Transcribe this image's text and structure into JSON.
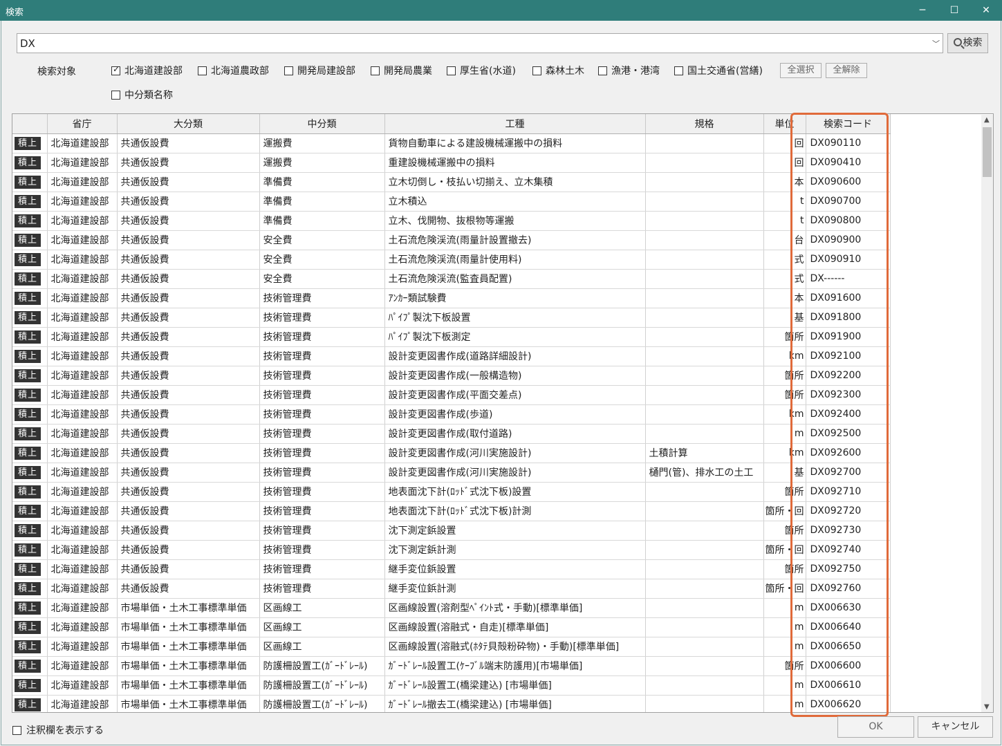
{
  "window": {
    "title": "検索",
    "min": "─",
    "max": "☐",
    "close": "✕"
  },
  "search": {
    "value": "DX",
    "button_label": "検索"
  },
  "targets": {
    "label": "検索対象",
    "items": [
      {
        "label": "北海道建設部",
        "checked": true
      },
      {
        "label": "北海道農政部",
        "checked": false
      },
      {
        "label": "開発局建設部",
        "checked": false
      },
      {
        "label": "開発局農業",
        "checked": false
      },
      {
        "label": "厚生省(水道)",
        "checked": false
      },
      {
        "label": "森林土木",
        "checked": false
      },
      {
        "label": "漁港・港湾",
        "checked": false
      },
      {
        "label": "国土交通省(営繕)",
        "checked": false
      }
    ],
    "select_all": "全選択",
    "clear_all": "全解除",
    "middle_name": {
      "label": "中分類名称",
      "checked": false
    }
  },
  "table": {
    "headers": [
      "",
      "省庁",
      "大分類",
      "中分類",
      "工種",
      "規格",
      "単位",
      "検索コード"
    ],
    "tag": "積上",
    "rows": [
      [
        "北海道建設部",
        "共通仮設費",
        "運搬費",
        "貨物自動車による建設機械運搬中の損料",
        "",
        "回",
        "DX090110"
      ],
      [
        "北海道建設部",
        "共通仮設費",
        "運搬費",
        "重建設機械運搬中の損料",
        "",
        "回",
        "DX090410"
      ],
      [
        "北海道建設部",
        "共通仮設費",
        "準備費",
        "立木切倒し・枝払い切揃え、立木集積",
        "",
        "本",
        "DX090600"
      ],
      [
        "北海道建設部",
        "共通仮設費",
        "準備費",
        "立木積込",
        "",
        "t",
        "DX090700"
      ],
      [
        "北海道建設部",
        "共通仮設費",
        "準備費",
        "立木、伐開物、抜根物等運搬",
        "",
        "t",
        "DX090800"
      ],
      [
        "北海道建設部",
        "共通仮設費",
        "安全費",
        "土石流危険渓流(雨量計設置撤去)",
        "",
        "台",
        "DX090900"
      ],
      [
        "北海道建設部",
        "共通仮設費",
        "安全費",
        "土石流危険渓流(雨量計使用料)",
        "",
        "式",
        "DX090910"
      ],
      [
        "北海道建設部",
        "共通仮設費",
        "安全費",
        "土石流危険渓流(監査員配置)",
        "",
        "式",
        "DX------"
      ],
      [
        "北海道建設部",
        "共通仮設費",
        "技術管理費",
        "ｱﾝｶｰ類試験費",
        "",
        "本",
        "DX091600"
      ],
      [
        "北海道建設部",
        "共通仮設費",
        "技術管理費",
        "ﾊﾟｲﾌﾟ製沈下板設置",
        "",
        "基",
        "DX091800"
      ],
      [
        "北海道建設部",
        "共通仮設費",
        "技術管理費",
        "ﾊﾟｲﾌﾟ製沈下板測定",
        "",
        "箇所",
        "DX091900"
      ],
      [
        "北海道建設部",
        "共通仮設費",
        "技術管理費",
        "設計変更図書作成(道路詳細設計)",
        "",
        "km",
        "DX092100"
      ],
      [
        "北海道建設部",
        "共通仮設費",
        "技術管理費",
        "設計変更図書作成(一般構造物)",
        "",
        "箇所",
        "DX092200"
      ],
      [
        "北海道建設部",
        "共通仮設費",
        "技術管理費",
        "設計変更図書作成(平面交差点)",
        "",
        "箇所",
        "DX092300"
      ],
      [
        "北海道建設部",
        "共通仮設費",
        "技術管理費",
        "設計変更図書作成(歩道)",
        "",
        "km",
        "DX092400"
      ],
      [
        "北海道建設部",
        "共通仮設費",
        "技術管理費",
        "設計変更図書作成(取付道路)",
        "",
        "m",
        "DX092500"
      ],
      [
        "北海道建設部",
        "共通仮設費",
        "技術管理費",
        "設計変更図書作成(河川実施設計)",
        "土積計算",
        "km",
        "DX092600"
      ],
      [
        "北海道建設部",
        "共通仮設費",
        "技術管理費",
        "設計変更図書作成(河川実施設計)",
        "樋門(管)、排水工の土工",
        "基",
        "DX092700"
      ],
      [
        "北海道建設部",
        "共通仮設費",
        "技術管理費",
        "地表面沈下計(ﾛｯﾄﾞ式沈下板)設置",
        "",
        "箇所",
        "DX092710"
      ],
      [
        "北海道建設部",
        "共通仮設費",
        "技術管理費",
        "地表面沈下計(ﾛｯﾄﾞ式沈下板)計測",
        "",
        "箇所・回",
        "DX092720"
      ],
      [
        "北海道建設部",
        "共通仮設費",
        "技術管理費",
        "沈下測定鋲設置",
        "",
        "箇所",
        "DX092730"
      ],
      [
        "北海道建設部",
        "共通仮設費",
        "技術管理費",
        "沈下測定鋲計測",
        "",
        "箇所・回",
        "DX092740"
      ],
      [
        "北海道建設部",
        "共通仮設費",
        "技術管理費",
        "継手変位鋲設置",
        "",
        "箇所",
        "DX092750"
      ],
      [
        "北海道建設部",
        "共通仮設費",
        "技術管理費",
        "継手変位鋲計測",
        "",
        "箇所・回",
        "DX092760"
      ],
      [
        "北海道建設部",
        "市場単価・土木工事標準単価",
        "区画線工",
        "区画線設置(溶剤型ﾍﾟｲﾝﾄ式・手動)[標準単価]",
        "",
        "m",
        "DX006630"
      ],
      [
        "北海道建設部",
        "市場単価・土木工事標準単価",
        "区画線工",
        "区画線設置(溶融式・自走)[標準単価]",
        "",
        "m",
        "DX006640"
      ],
      [
        "北海道建設部",
        "市場単価・土木工事標準単価",
        "区画線工",
        "区画線設置(溶融式(ﾎﾀﾃ貝殻粉砕物)・手動)[標準単価]",
        "",
        "m",
        "DX006650"
      ],
      [
        "北海道建設部",
        "市場単価・土木工事標準単価",
        "防護柵設置工(ｶﾞｰﾄﾞﾚｰﾙ)",
        "ｶﾞｰﾄﾞﾚｰﾙ設置工(ｹｰﾌﾞﾙ端末防護用)[市場単価]",
        "",
        "箇所",
        "DX006600"
      ],
      [
        "北海道建設部",
        "市場単価・土木工事標準単価",
        "防護柵設置工(ｶﾞｰﾄﾞﾚｰﾙ)",
        "ｶﾞｰﾄﾞﾚｰﾙ設置工(橋梁建込) [市場単価]",
        "",
        "m",
        "DX006610"
      ],
      [
        "北海道建設部",
        "市場単価・土木工事標準単価",
        "防護柵設置工(ｶﾞｰﾄﾞﾚｰﾙ)",
        "ｶﾞｰﾄﾞﾚｰﾙ撤去工(橋梁建込) [市場単価]",
        "",
        "m",
        "DX006620"
      ]
    ]
  },
  "footer": {
    "show_notes": {
      "label": "注釈欄を表示する",
      "checked": false
    },
    "ok": "OK",
    "cancel": "キャンセル"
  },
  "highlight_color": "#e06a3a"
}
